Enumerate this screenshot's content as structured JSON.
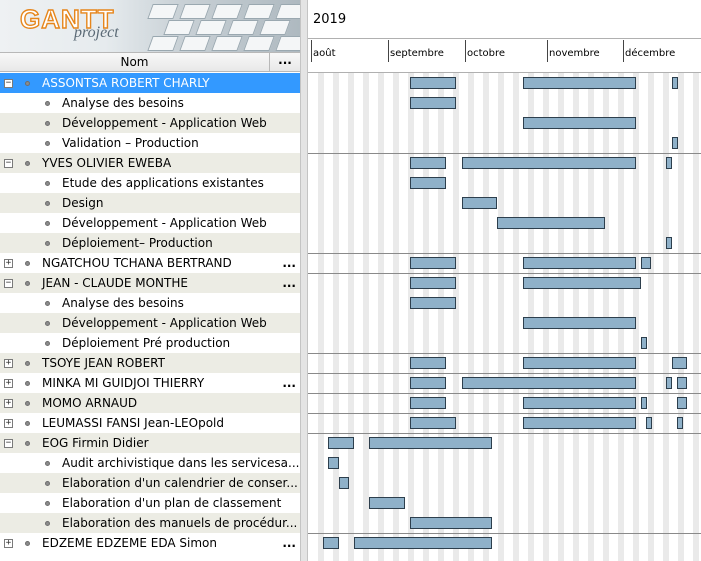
{
  "app": {
    "logo_text": "GANTT",
    "logo_subtext": "project"
  },
  "tree": {
    "header_name": "Nom",
    "header_more": "...",
    "rows": [
      {
        "name": "ASSONTSA ROBERT CHARLY",
        "level": 0,
        "toggle": "−",
        "selected": true,
        "bars": [
          [
            19,
            28
          ],
          [
            41,
            63
          ],
          [
            70,
            71
          ]
        ]
      },
      {
        "name": "Analyse des besoins",
        "level": 1,
        "bars": [
          [
            19,
            28
          ]
        ]
      },
      {
        "name": "Développement - Application Web",
        "level": 1,
        "bars": [
          [
            41,
            63
          ]
        ]
      },
      {
        "name": "Validation – Production",
        "level": 1,
        "bars": [
          [
            70,
            71
          ]
        ]
      },
      {
        "name": "YVES OLIVIER EWEBA",
        "level": 0,
        "toggle": "−",
        "bars": [
          [
            19,
            26
          ],
          [
            29,
            63
          ],
          [
            69,
            70
          ]
        ]
      },
      {
        "name": "Etude des applications existantes",
        "level": 1,
        "bars": [
          [
            19,
            26
          ]
        ]
      },
      {
        "name": "Design",
        "level": 1,
        "bars": [
          [
            29,
            36
          ]
        ]
      },
      {
        "name": "Développement - Application Web",
        "level": 1,
        "bars": [
          [
            36,
            57
          ]
        ]
      },
      {
        "name": "Déploiement– Production",
        "level": 1,
        "bars": [
          [
            69,
            70
          ]
        ]
      },
      {
        "name": "NGATCHOU TCHANA BERTRAND",
        "level": 0,
        "toggle": "+",
        "more": true,
        "bars": [
          [
            19,
            28
          ],
          [
            41,
            63
          ],
          [
            64,
            66
          ]
        ]
      },
      {
        "name": "JEAN - CLAUDE MONTHE",
        "level": 0,
        "toggle": "−",
        "more": true,
        "bars": [
          [
            19,
            28
          ],
          [
            41,
            64
          ]
        ]
      },
      {
        "name": "Analyse des besoins",
        "level": 1,
        "bars": [
          [
            19,
            28
          ]
        ]
      },
      {
        "name": "Développement - Application Web",
        "level": 1,
        "bars": [
          [
            41,
            63
          ]
        ]
      },
      {
        "name": "Déploiement Pré production",
        "level": 1,
        "bars": [
          [
            64,
            65
          ]
        ]
      },
      {
        "name": "TSOYE JEAN ROBERT",
        "level": 0,
        "toggle": "+",
        "bars": [
          [
            19,
            26
          ],
          [
            41,
            63
          ],
          [
            70,
            73
          ]
        ]
      },
      {
        "name": "MINKA MI GUIDJOI THIERRY",
        "level": 0,
        "toggle": "+",
        "more": true,
        "bars": [
          [
            19,
            26
          ],
          [
            29,
            63
          ],
          [
            69,
            70
          ],
          [
            71,
            73
          ]
        ]
      },
      {
        "name": "MOMO ARNAUD",
        "level": 0,
        "toggle": "+",
        "bars": [
          [
            19,
            26
          ],
          [
            41,
            63
          ],
          [
            64,
            65
          ],
          [
            71,
            73
          ]
        ]
      },
      {
        "name": "LEUMASSI FANSI Jean-LEOpold",
        "level": 0,
        "toggle": "+",
        "bars": [
          [
            19,
            28
          ],
          [
            41,
            63
          ],
          [
            65,
            66
          ],
          [
            71,
            72
          ]
        ]
      },
      {
        "name": "EOG Firmin Didier",
        "level": 0,
        "toggle": "−",
        "bars": [
          [
            3,
            8
          ],
          [
            11,
            35
          ]
        ]
      },
      {
        "name": "Audit archivistique dans les servicesa...",
        "level": 1,
        "bars": [
          [
            3,
            5
          ]
        ]
      },
      {
        "name": "Elaboration d'un calendrier de conser...",
        "level": 1,
        "bars": [
          [
            5,
            7
          ]
        ]
      },
      {
        "name": "Elaboration d'un plan de classement",
        "level": 1,
        "bars": [
          [
            11,
            18
          ]
        ]
      },
      {
        "name": "Elaboration des manuels de procédur...",
        "level": 1,
        "bars": [
          [
            19,
            35
          ]
        ]
      },
      {
        "name": "EDZEME EDZEME EDA Simon",
        "level": 0,
        "toggle": "+",
        "more": true,
        "bars": [
          [
            2,
            5
          ],
          [
            8,
            35
          ]
        ]
      }
    ]
  },
  "chart": {
    "year": "2019",
    "months": [
      {
        "label": "août",
        "day": 0
      },
      {
        "label": "septembre",
        "day": 15
      },
      {
        "label": "octobre",
        "day": 30
      },
      {
        "label": "novembre",
        "day": 46
      },
      {
        "label": "décembre",
        "day": 61
      }
    ]
  },
  "colors": {
    "selection": "#3399ff",
    "bar_fill": "#8fb1c9",
    "bar_border": "#2d3f4d",
    "row_alt": "#ecece4"
  }
}
